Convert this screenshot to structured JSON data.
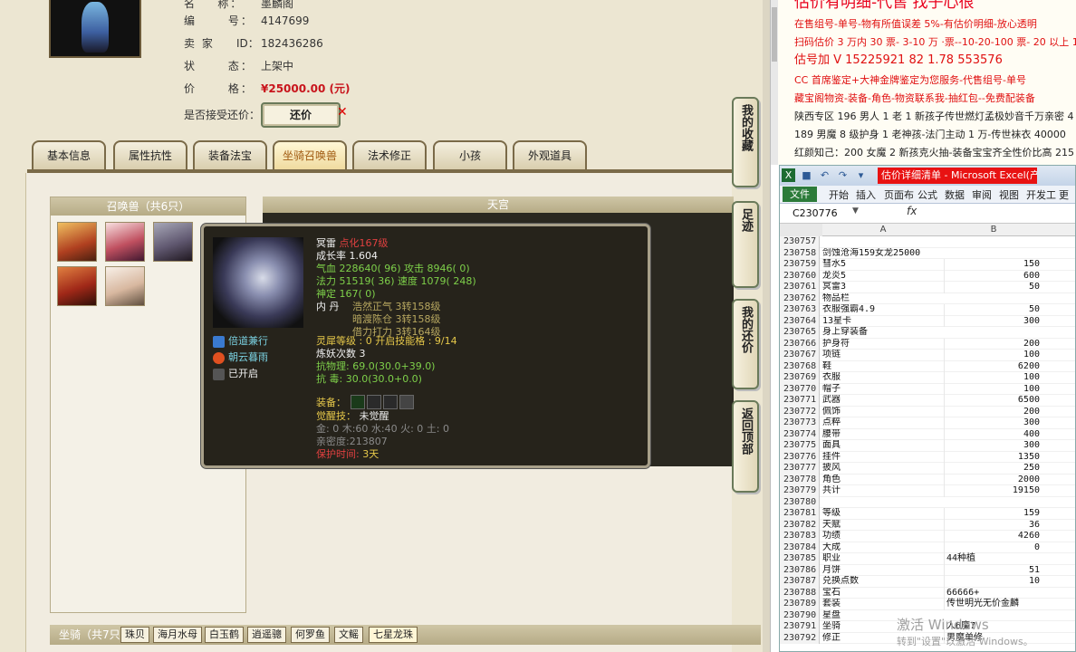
{
  "listing": {
    "name_label": "名",
    "name_label_prefix": "称：",
    "name_value": "墨麟阁",
    "id_label_1": "编",
    "id_label_2": "号：",
    "id_value": "4147699",
    "seller_label": "卖  家",
    "seller_id_label": "ID：",
    "seller_id_value": "182436286",
    "status_label_1": "状",
    "status_label_2": "态：",
    "status_value": "上架中",
    "price_label_1": "价",
    "price_label_2": "格：",
    "price_value": "¥25000.00 (元)",
    "bargain_question": "是否接受还价：",
    "bargain_button": "还价"
  },
  "tabs": [
    "基本信息",
    "属性抗性",
    "装备法宝",
    "坐骑召唤兽",
    "法术修正",
    "小孩",
    "外观道具"
  ],
  "active_tab": "坐骑召唤兽",
  "pets_panel": {
    "title": "召唤兽（共6只）"
  },
  "tianguan_title": "天宫",
  "side_buttons": [
    "我的收藏",
    "足迹",
    "我的还价",
    "返回顶部"
  ],
  "popup": {
    "name": "冥雷",
    "name_suffix": "点化167级",
    "growth": "成长率 1.604",
    "hp": "气血 228640( 96) 攻击 8946( 0)",
    "mp": "法力 51519( 36) 速度 1079( 248)",
    "god": "神定 167( 0)",
    "core_label": "内  丹",
    "core1": "浩然正气 3转158级",
    "core2": "暗渡陈仓 3转158级",
    "core3": "借力打力 3转164级",
    "skill1": "倍道兼行",
    "skill2": "朝云暮雨",
    "skill3": "已开启",
    "lingxi": "灵犀等级 : 0 开启技能格 : 9/14",
    "lianyao": "炼妖次数 3",
    "kangwuli": "抗物理: 69.0(30.0+39.0)",
    "kangdu": "抗  毒: 30.0(30.0+0.0)",
    "equip_label": "装备：",
    "awaken_label": "觉醒技：",
    "awaken_value": "未觉醒",
    "elements": "金: 0 木:60 水:40 火: 0 土: 0",
    "intimacy": "亲密度:213807",
    "protect_label": "保护时间:",
    "protect_value": "3天"
  },
  "mount_bar": {
    "label": "坐骑（共7只",
    "tabs": [
      "珠贝",
      "海月水母",
      "白玉鹤",
      "逍遥骢",
      "何罗鱼",
      "文鳐",
      "七星龙珠"
    ],
    "active": "七星龙珠"
  },
  "ad": {
    "line1": "估价有明细-代售 找子心很",
    "line2": "在售组号-单号-物有所值误差 5%-有估价明细-放心透明",
    "line3": "扫码估价 3 万内 30 票- 3-10 万 ·票--10-20-100 票- 20 以上 150",
    "line4": "估号加 V 15225921 82 1.78 553576",
    "line5": "CC 首席鉴定+大神金牌鉴定为您服务-代售组号-单号",
    "line6": "藏宝阁物资-装备-角色-物资联系我-抽红包--免费配装备",
    "line7": "陕西专区 196 男人 1 老 1 新孩子传世燃灯孟极妙音千万亲密 4",
    "line8": "189 男魔 8 级护身 1 老神孩-法门主动 1 万-传世袜衣 40000",
    "line9": "红颜知己：200 女魔 2 新孩克火抽-装备宝宝齐全性价比高 215"
  },
  "excel": {
    "window_title": "估价详细清单 - Microsoft Excel(产品...",
    "ribbon_tabs": [
      "文件",
      "开始",
      "插入",
      "页面布",
      "公式",
      "数据",
      "审阅",
      "视图",
      "开发工",
      "更多"
    ],
    "name_box": "C230776",
    "fx": "fx",
    "col_a": "A",
    "col_b": "B",
    "rows": [
      {
        "n": "230757",
        "a": "",
        "b": ""
      },
      {
        "n": "230758",
        "a": "剑蚀沧海159女龙25000",
        "b": ""
      },
      {
        "n": "230759",
        "a": "彗水5",
        "b": "150"
      },
      {
        "n": "230760",
        "a": "龙炎5",
        "b": "600"
      },
      {
        "n": "230761",
        "a": "冥雷3",
        "b": "50"
      },
      {
        "n": "230762",
        "a": "物品栏",
        "b": ""
      },
      {
        "n": "230763",
        "a": "衣服强霸4.9",
        "b": "50"
      },
      {
        "n": "230764",
        "a": "13星卡",
        "b": "300"
      },
      {
        "n": "230765",
        "a": "身上穿装备",
        "b": ""
      },
      {
        "n": "230766",
        "a": "护身符",
        "b": "200"
      },
      {
        "n": "230767",
        "a": "项链",
        "b": "100"
      },
      {
        "n": "230768",
        "a": "鞋",
        "b": "6200"
      },
      {
        "n": "230769",
        "a": "衣服",
        "b": "100"
      },
      {
        "n": "230770",
        "a": "帽子",
        "b": "100"
      },
      {
        "n": "230771",
        "a": "武器",
        "b": "6500"
      },
      {
        "n": "230772",
        "a": "佩饰",
        "b": "200"
      },
      {
        "n": "230773",
        "a": "点粹",
        "b": "300"
      },
      {
        "n": "230774",
        "a": "腰带",
        "b": "400"
      },
      {
        "n": "230775",
        "a": "面具",
        "b": "300"
      },
      {
        "n": "230776",
        "a": "挂件",
        "b": "1350"
      },
      {
        "n": "230777",
        "a": "披风",
        "b": "250"
      },
      {
        "n": "230778",
        "a": "角色",
        "b": "2000"
      },
      {
        "n": "230779",
        "a": "共计",
        "b": "19150"
      },
      {
        "n": "230780",
        "a": "",
        "b": ""
      },
      {
        "n": "230781",
        "a": "等级",
        "b": "159"
      },
      {
        "n": "230782",
        "a": "天赋",
        "b": "36"
      },
      {
        "n": "230783",
        "a": "功绩",
        "b": "4260"
      },
      {
        "n": "230784",
        "a": "大成",
        "b": "0"
      },
      {
        "n": "230785",
        "a": "职业",
        "b": "44种植",
        "left": true
      },
      {
        "n": "230786",
        "a": "月饼",
        "b": "51"
      },
      {
        "n": "230787",
        "a": "兑换点数",
        "b": "10"
      },
      {
        "n": "230788",
        "a": "宝石",
        "b": "66666+",
        "left": true
      },
      {
        "n": "230789",
        "a": "套装",
        "b": "传世明光无价金麟",
        "left": true
      },
      {
        "n": "230790",
        "a": "星盘",
        "b": "",
        "left": true
      },
      {
        "n": "230791",
        "a": "坐骑",
        "b": "人6魔7",
        "left": true
      },
      {
        "n": "230792",
        "a": "修正",
        "b": "男魔单修",
        "left": true
      }
    ]
  },
  "watermark": {
    "line1": "激活 Windows",
    "line2": "转到\"设置\"以激活 Windows。"
  },
  "colors": {
    "price_red": "#c8141c",
    "ad_red": "#e8001c",
    "popup_bg": "#26231b",
    "excel_file_tab": "#2c7b3a",
    "excel_title_caption": "#e81212"
  }
}
